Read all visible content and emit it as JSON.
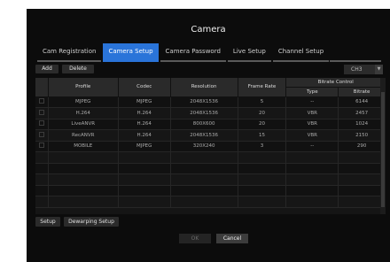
{
  "window": {
    "title": "Camera"
  },
  "tabs": [
    {
      "label": "Cam Registration",
      "active": false
    },
    {
      "label": "Camera Setup",
      "active": true
    },
    {
      "label": "Camera Password",
      "active": false
    },
    {
      "label": "Live Setup",
      "active": false
    },
    {
      "label": "Channel Setup",
      "active": false
    }
  ],
  "toolbar": {
    "add_label": "Add",
    "delete_label": "Delete",
    "channel_select": "CH3"
  },
  "table": {
    "headers": {
      "profile": "Profile",
      "codec": "Codec",
      "resolution": "Resolution",
      "frame_rate": "Frame Rate",
      "bitrate_control": "Bitrate Control",
      "type": "Type",
      "bitrate": "Bitrate"
    },
    "rows": [
      {
        "profile": "MJPEG",
        "codec": "MJPEG",
        "resolution": "2048X1536",
        "frame_rate": "5",
        "type": "--",
        "bitrate": "6144"
      },
      {
        "profile": "H.264",
        "codec": "H.264",
        "resolution": "2048X1536",
        "frame_rate": "20",
        "type": "VBR",
        "bitrate": "2457"
      },
      {
        "profile": "LiveANVR",
        "codec": "H.264",
        "resolution": "800X600",
        "frame_rate": "20",
        "type": "VBR",
        "bitrate": "1024"
      },
      {
        "profile": "RecANVR",
        "codec": "H.264",
        "resolution": "2048X1536",
        "frame_rate": "15",
        "type": "VBR",
        "bitrate": "2150"
      },
      {
        "profile": "MOBILE",
        "codec": "MJPEG",
        "resolution": "320X240",
        "frame_rate": "3",
        "type": "--",
        "bitrate": "290"
      }
    ]
  },
  "bottom": {
    "setup_label": "Setup",
    "dewarping_label": "Dewarping Setup",
    "ok_label": "OK",
    "cancel_label": "Cancel"
  },
  "colors": {
    "accent": "#2a74d9",
    "background": "#0c0c0c"
  }
}
